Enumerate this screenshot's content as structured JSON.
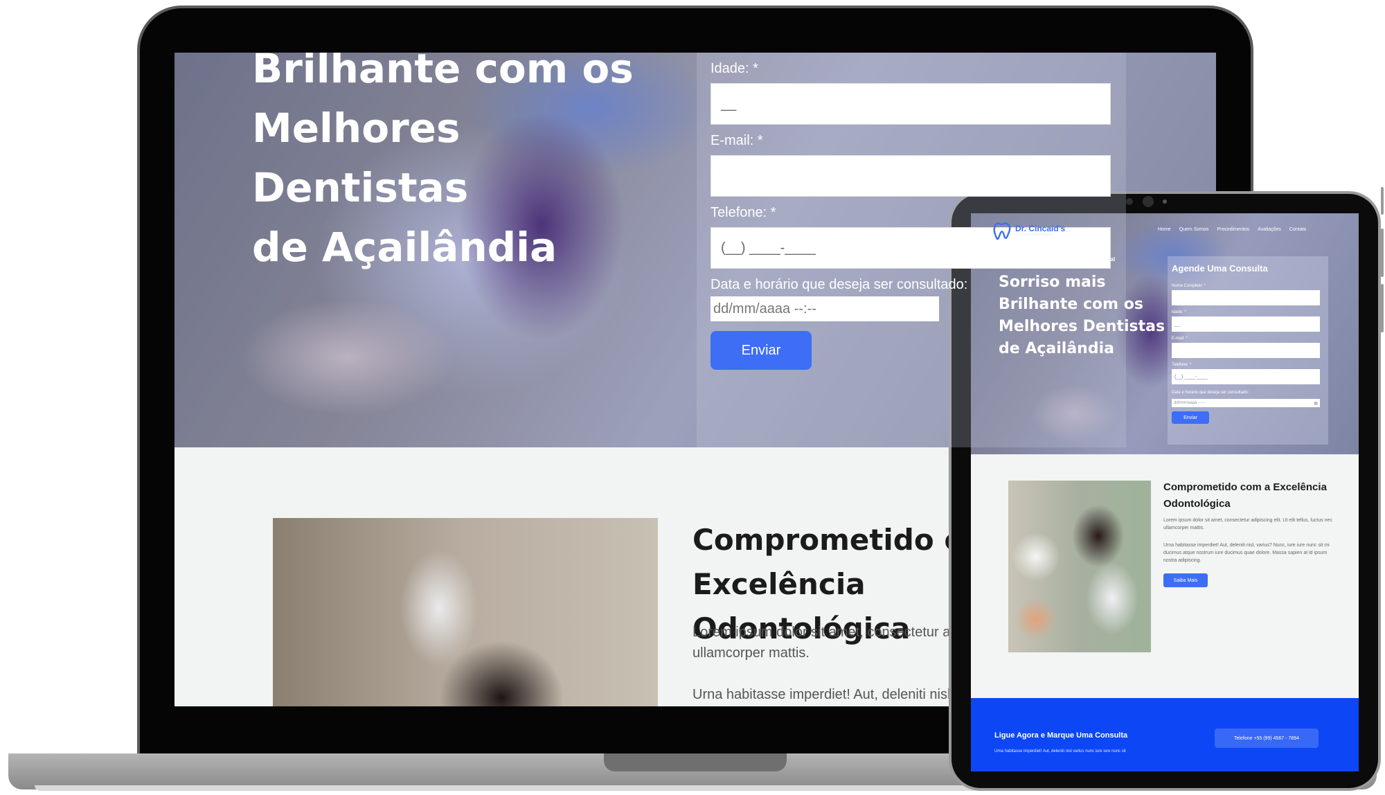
{
  "laptop": {
    "hero": {
      "title_line1": "Brilhante com os",
      "title_line2": "Melhores Dentistas",
      "title_line3": "de Açailândia"
    },
    "form": {
      "age_label": "Idade: *",
      "age_value": "__",
      "email_label": "E-mail: *",
      "phone_label": "Telefone: *",
      "phone_value": "(__) ____-____",
      "date_label": "Data e horário que deseja ser consultado:",
      "date_placeholder": "dd/mm/aaaa --:--",
      "submit_label": "Enviar"
    },
    "about": {
      "heading_line1": "Comprometido com a Excelência",
      "heading_line2": "Odontológica",
      "paragraph1": "Lorem ipsum dolor sit amet, consectetur adipiscing elit. Ut elit tellus, luctus nec ullamcorper mattis.",
      "paragraph2": "Urna habitasse imperdiet! Aut, deleniti nisl, varius? Nunc, iure iure nunc sit mi ducimus atque nostrum iure ducimus quae dolore."
    }
  },
  "tablet": {
    "brand": "Dr. Cincaid's",
    "brand_sub": "Clínica Odontológica",
    "nav": [
      "Home",
      "Quem Somos",
      "Procedimentos",
      "Avaliações",
      "Contato"
    ],
    "tagline": "Cuidamos com seriedade a sua saúde bocal",
    "hero_title": "Sorriso mais Brilhante com os Melhores Dentistas de Açailândia",
    "form": {
      "title": "Agende Uma Consulta",
      "name_label": "Nome Completo: *",
      "age_label": "Idade: *",
      "age_value": "__",
      "email_label": "E-mail: *",
      "phone_label": "Telefone: *",
      "phone_value": "(__) ____-____",
      "date_label": "Data e horário que deseja ser consultado:",
      "date_placeholder": "dd/mm/aaaa --:--",
      "submit_label": "Enviar"
    },
    "about": {
      "heading": "Comprometido com a Excelência Odontológica",
      "paragraph1": "Lorem ipsum dolor sit amet, consectetur adipiscing elit. Ut elit tellus, luctus nec ullamcorper mattis.",
      "paragraph2": "Urna habitasse imperdiet! Aut, deleniti nisl, varius? Nunc, iure iure nunc sit mi ducimus atque nostrum iure ducimus quae dolore. Massa sapien at id ipsum nostra adipiscing.",
      "button_label": "Saiba Mais"
    },
    "cta": {
      "title": "Ligue Agora e Marque Uma Consulta",
      "subtitle": "Urna habitasse imperdiet! Aut, deleniti nisl varius nunc iure iure nunc sit",
      "phone_button": "Telefone +55 (99) 4567 - 7894"
    }
  },
  "colors": {
    "accent": "#3d6ef5",
    "cta_background": "#0d47f5",
    "hero_overlay": "#505fbe"
  }
}
